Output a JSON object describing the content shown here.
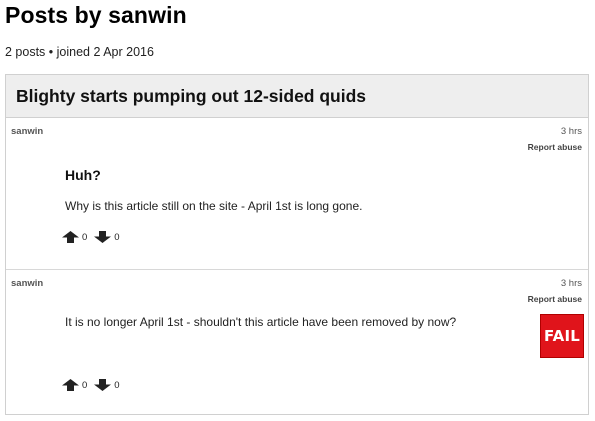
{
  "page": {
    "title": "Posts by sanwin",
    "meta": "2 posts • joined 2 Apr 2016"
  },
  "article": {
    "title": "Blighty starts pumping out 12-sided quids"
  },
  "comments": [
    {
      "author": "sanwin",
      "time": "3 hrs",
      "report_label": "Report abuse",
      "title": "Huh?",
      "body": "Why is this article still on the site - April 1st is long gone.",
      "upvotes": "0",
      "downvotes": "0"
    },
    {
      "author": "sanwin",
      "time": "3 hrs",
      "report_label": "Report abuse",
      "body": "It is no longer April 1st - shouldn't this article have been removed by now?",
      "upvotes": "0",
      "downvotes": "0",
      "icon": {
        "name": "fail-icon",
        "text": "FAIL",
        "color": "#e0141b"
      }
    }
  ],
  "icons": {
    "upvote": "thumbs-up-icon",
    "downvote": "thumbs-down-icon"
  }
}
